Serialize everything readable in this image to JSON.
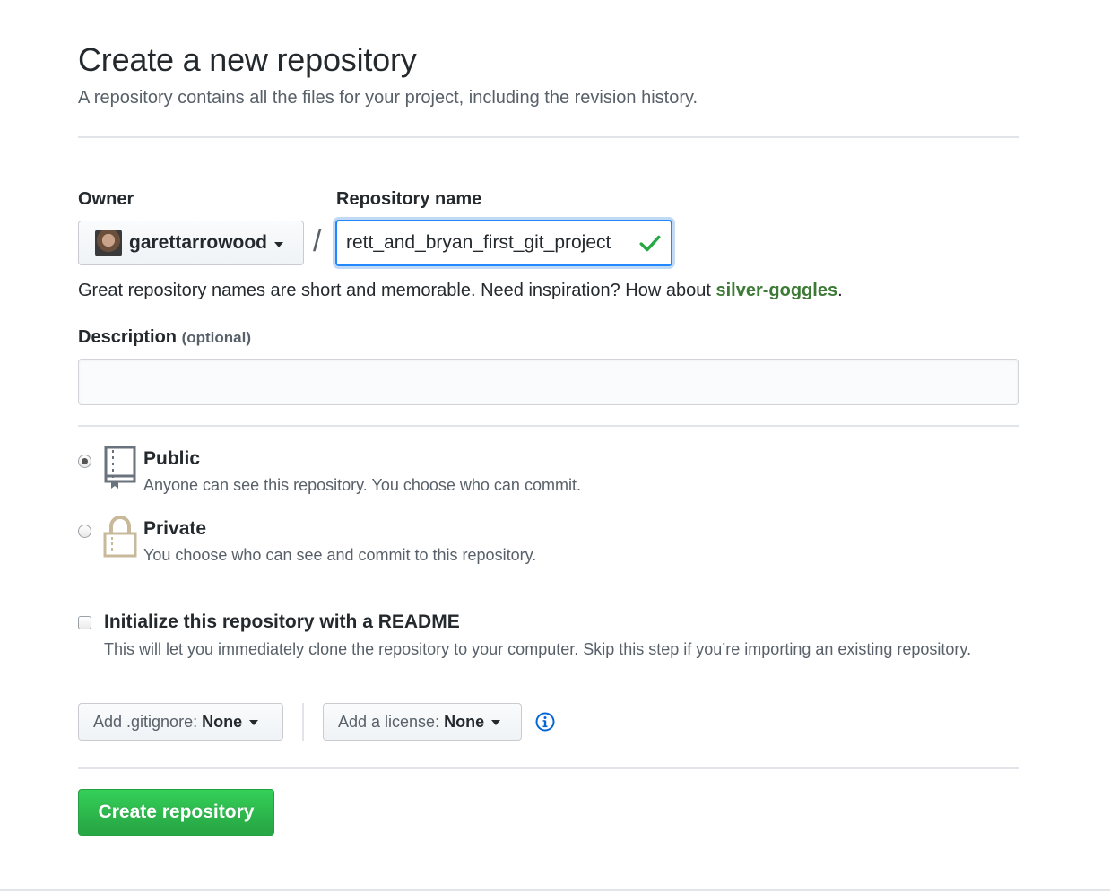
{
  "header": {
    "title": "Create a new repository",
    "subtitle": "A repository contains all the files for your project, including the revision history."
  },
  "owner": {
    "label": "Owner",
    "value": "garettarrowood"
  },
  "repo": {
    "label": "Repository name",
    "separator": "/",
    "value": "rett_and_bryan_first_git_project"
  },
  "hint": {
    "text": "Great repository names are short and memorable. Need inspiration? How about ",
    "suggestion": "silver-goggles",
    "end": "."
  },
  "description": {
    "label": "Description",
    "optional": "(optional)",
    "value": ""
  },
  "visibility": {
    "public": {
      "title": "Public",
      "desc": "Anyone can see this repository. You choose who can commit.",
      "checked": true
    },
    "private": {
      "title": "Private",
      "desc": "You choose who can see and commit to this repository.",
      "checked": false
    }
  },
  "readme": {
    "title": "Initialize this repository with a README",
    "desc": "This will let you immediately clone the repository to your computer. Skip this step if you’re importing an existing repository.",
    "checked": false
  },
  "gitignore": {
    "label": "Add .gitignore:",
    "value": "None"
  },
  "license": {
    "label": "Add a license:",
    "value": "None"
  },
  "submit": {
    "label": "Create repository"
  },
  "colors": {
    "accent_blue": "#2188ff",
    "success_green": "#28a745",
    "suggestion_green": "#3d7a35",
    "info_blue": "#0366d6"
  },
  "icons": {
    "valid": "check-icon",
    "public": "repo-book-icon",
    "private": "lock-icon",
    "info": "info-icon"
  }
}
